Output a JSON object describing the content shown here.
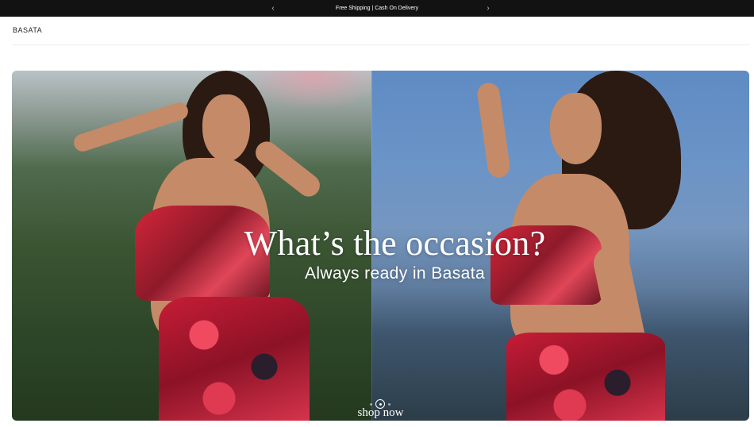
{
  "announcement": {
    "text": "Free Shipping | Cash On Delivery",
    "prev_icon": "‹",
    "next_icon": "›"
  },
  "header": {
    "logo": "BASATA"
  },
  "hero": {
    "headline": "What’s the occasion?",
    "subheadline": "Always ready in Basata",
    "cta": "shop now",
    "slides_total": 3,
    "active_slide": 2
  }
}
